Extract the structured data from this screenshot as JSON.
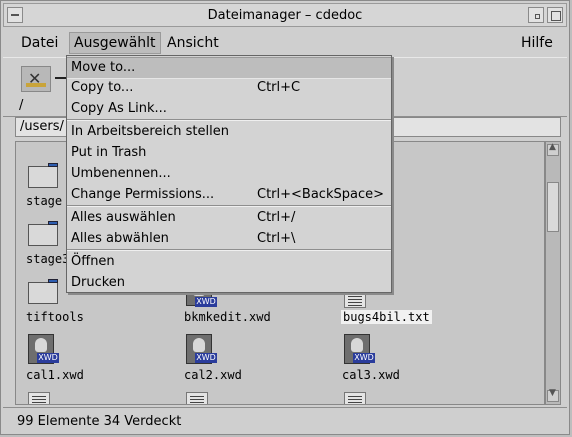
{
  "window": {
    "title": "Dateimanager – cdedoc"
  },
  "menubar": {
    "items": [
      {
        "label": "Datei"
      },
      {
        "label": "Ausgewählt"
      },
      {
        "label": "Ansicht"
      },
      {
        "label": "Hilfe"
      }
    ]
  },
  "toolbar": {
    "path_symbol": "/"
  },
  "pathfield": {
    "value": "/users/"
  },
  "dropdown": {
    "items": [
      {
        "label": "Move to...",
        "shortcut": ""
      },
      {
        "label": "Copy to...",
        "shortcut": "Ctrl+C"
      },
      {
        "label": "Copy As Link...",
        "shortcut": ""
      },
      {
        "label": "In Arbeitsbereich stellen",
        "shortcut": ""
      },
      {
        "label": "Put in Trash",
        "shortcut": ""
      },
      {
        "label": "Umbenennen...",
        "shortcut": ""
      },
      {
        "label": "Change Permissions...",
        "shortcut": "Ctrl+<BackSpace>"
      },
      {
        "label": "Alles auswählen",
        "shortcut": "Ctrl+/"
      },
      {
        "label": "Alles abwählen",
        "shortcut": "Ctrl+\\"
      },
      {
        "label": "Öffnen",
        "shortcut": ""
      },
      {
        "label": "Drucken",
        "shortcut": ""
      }
    ]
  },
  "files": {
    "stage": "stage",
    "stage3": "stage3",
    "tiftools": "tiftools",
    "bkmkedit": "bkmkedit.xwd",
    "bugs4bil": "bugs4bil.txt",
    "cal1": "cal1.xwd",
    "cal2": "cal2.xwd",
    "cal3": "cal3.xwd",
    "xwd_tag": "XWD"
  },
  "status": {
    "text": "99 Elemente 34 Verdeckt"
  }
}
